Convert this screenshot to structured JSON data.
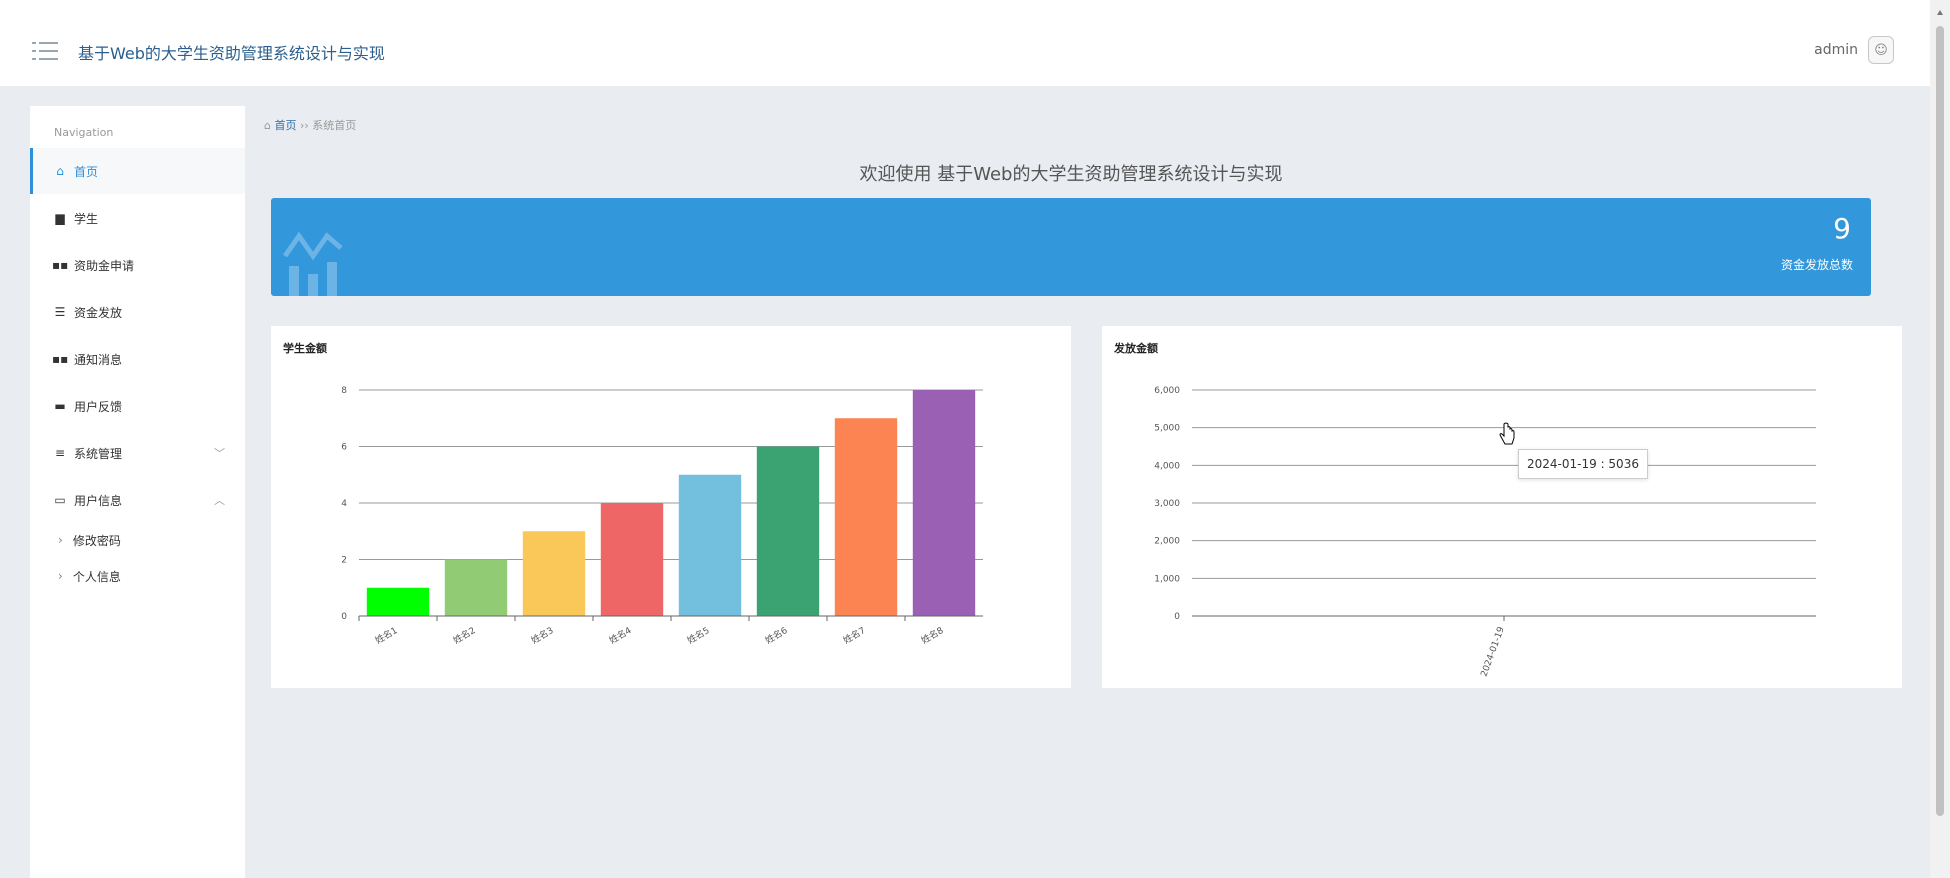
{
  "header": {
    "app_title": "基于Web的大学生资助管理系统设计与实现",
    "user_name": "admin"
  },
  "sidebar": {
    "heading": "Navigation",
    "items": [
      {
        "label": "首页",
        "icon": "home-icon",
        "active": true
      },
      {
        "label": "学生",
        "icon": "briefcase-icon"
      },
      {
        "label": "资助金申请",
        "icon": "grid-icon"
      },
      {
        "label": "资金发放",
        "icon": "sliders-icon"
      },
      {
        "label": "通知消息",
        "icon": "grid-icon"
      },
      {
        "label": "用户反馈",
        "icon": "monitor-icon"
      },
      {
        "label": "系统管理",
        "icon": "list-icon",
        "chevron": "down"
      },
      {
        "label": "用户信息",
        "icon": "card-icon",
        "chevron": "up"
      }
    ],
    "sub_items": [
      "修改密码",
      "个人信息"
    ]
  },
  "breadcrumb": {
    "home": "首页",
    "separator": "››",
    "current": "系统首页"
  },
  "welcome_text": "欢迎使用 基于Web的大学生资助管理系统设计与实现",
  "stat_card": {
    "value": "9",
    "label": "资金发放总数",
    "color": "#3397db"
  },
  "tooltip": "2024-01-19 : 5036",
  "chart_data": [
    {
      "type": "bar",
      "title": "学生金额",
      "categories": [
        "姓名1",
        "姓名2",
        "姓名3",
        "姓名4",
        "姓名5",
        "姓名6",
        "姓名7",
        "姓名8"
      ],
      "values": [
        1,
        2,
        3,
        4,
        5,
        6,
        7,
        8
      ],
      "colors": [
        "#00ff00",
        "#91cc75",
        "#fac858",
        "#ee6666",
        "#73c0de",
        "#3ba272",
        "#fc8452",
        "#9a60b4"
      ],
      "ylim": [
        0,
        8
      ],
      "yticks": [
        0,
        2,
        4,
        6,
        8
      ],
      "grid": true
    },
    {
      "type": "bar",
      "title": "发放金额",
      "categories": [
        "2024-01-19"
      ],
      "values": [
        5036
      ],
      "ylim": [
        0,
        6000
      ],
      "yticks": [
        "0",
        "1,000",
        "2,000",
        "3,000",
        "4,000",
        "5,000",
        "6,000"
      ],
      "grid": true
    }
  ]
}
